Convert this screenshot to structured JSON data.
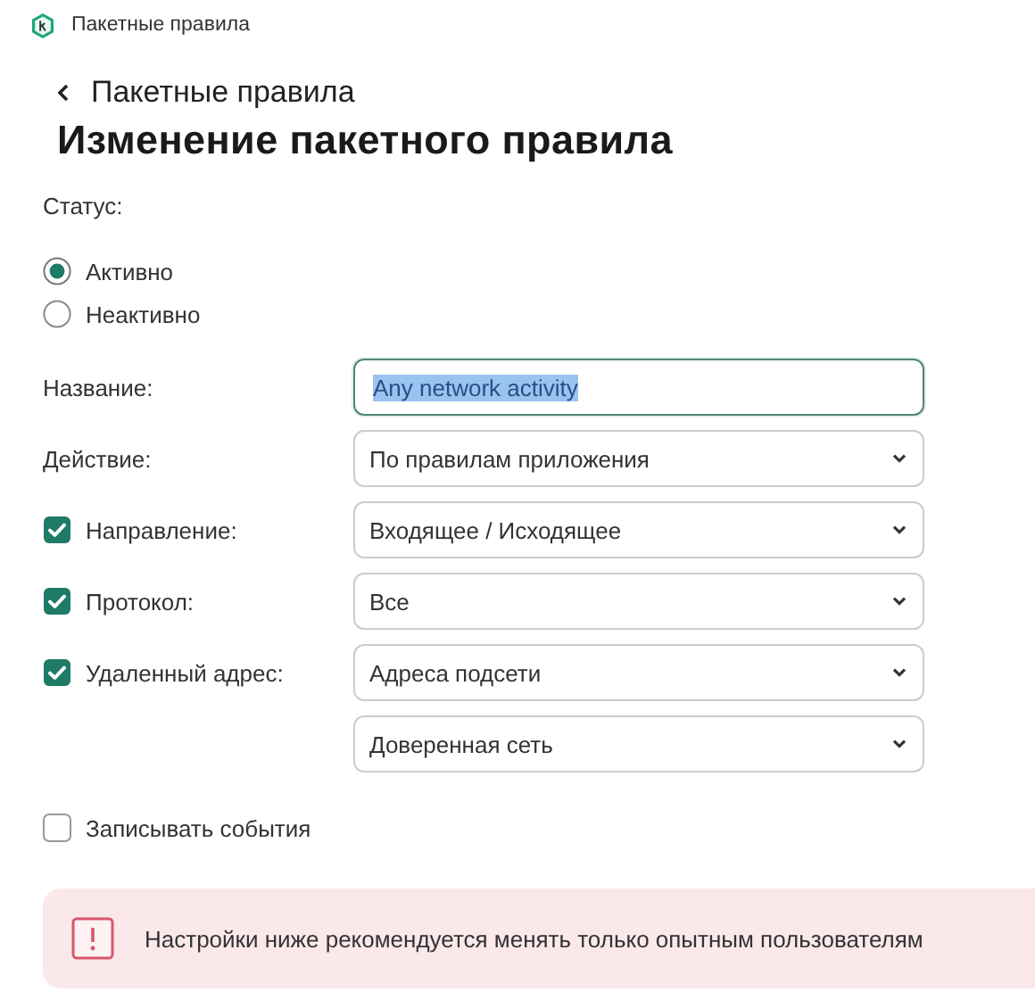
{
  "window": {
    "title": "Пакетные правила"
  },
  "header": {
    "back_label": "Пакетные правила",
    "title": "Изменение пакетного правила"
  },
  "status": {
    "label": "Статус:",
    "options": [
      {
        "label": "Активно",
        "selected": true
      },
      {
        "label": "Неактивно",
        "selected": false
      }
    ]
  },
  "fields": [
    {
      "kind": "text",
      "label": "Название:",
      "value": "Any network activity",
      "value_selected": true
    },
    {
      "kind": "select",
      "label": "Действие:",
      "value": "По правилам приложения"
    },
    {
      "kind": "select",
      "label": "Направление:",
      "checked": true,
      "value": "Входящее / Исходящее"
    },
    {
      "kind": "select",
      "label": "Протокол:",
      "checked": true,
      "value": "Все"
    },
    {
      "kind": "select",
      "label": "Удаленный адрес:",
      "checked": true,
      "value": "Адреса подсети"
    },
    {
      "kind": "select",
      "value": "Доверенная сеть"
    }
  ],
  "log_events": {
    "label": "Записывать события",
    "checked": false
  },
  "warning": {
    "text": "Настройки ниже рекомендуется менять только опытным пользователям"
  }
}
